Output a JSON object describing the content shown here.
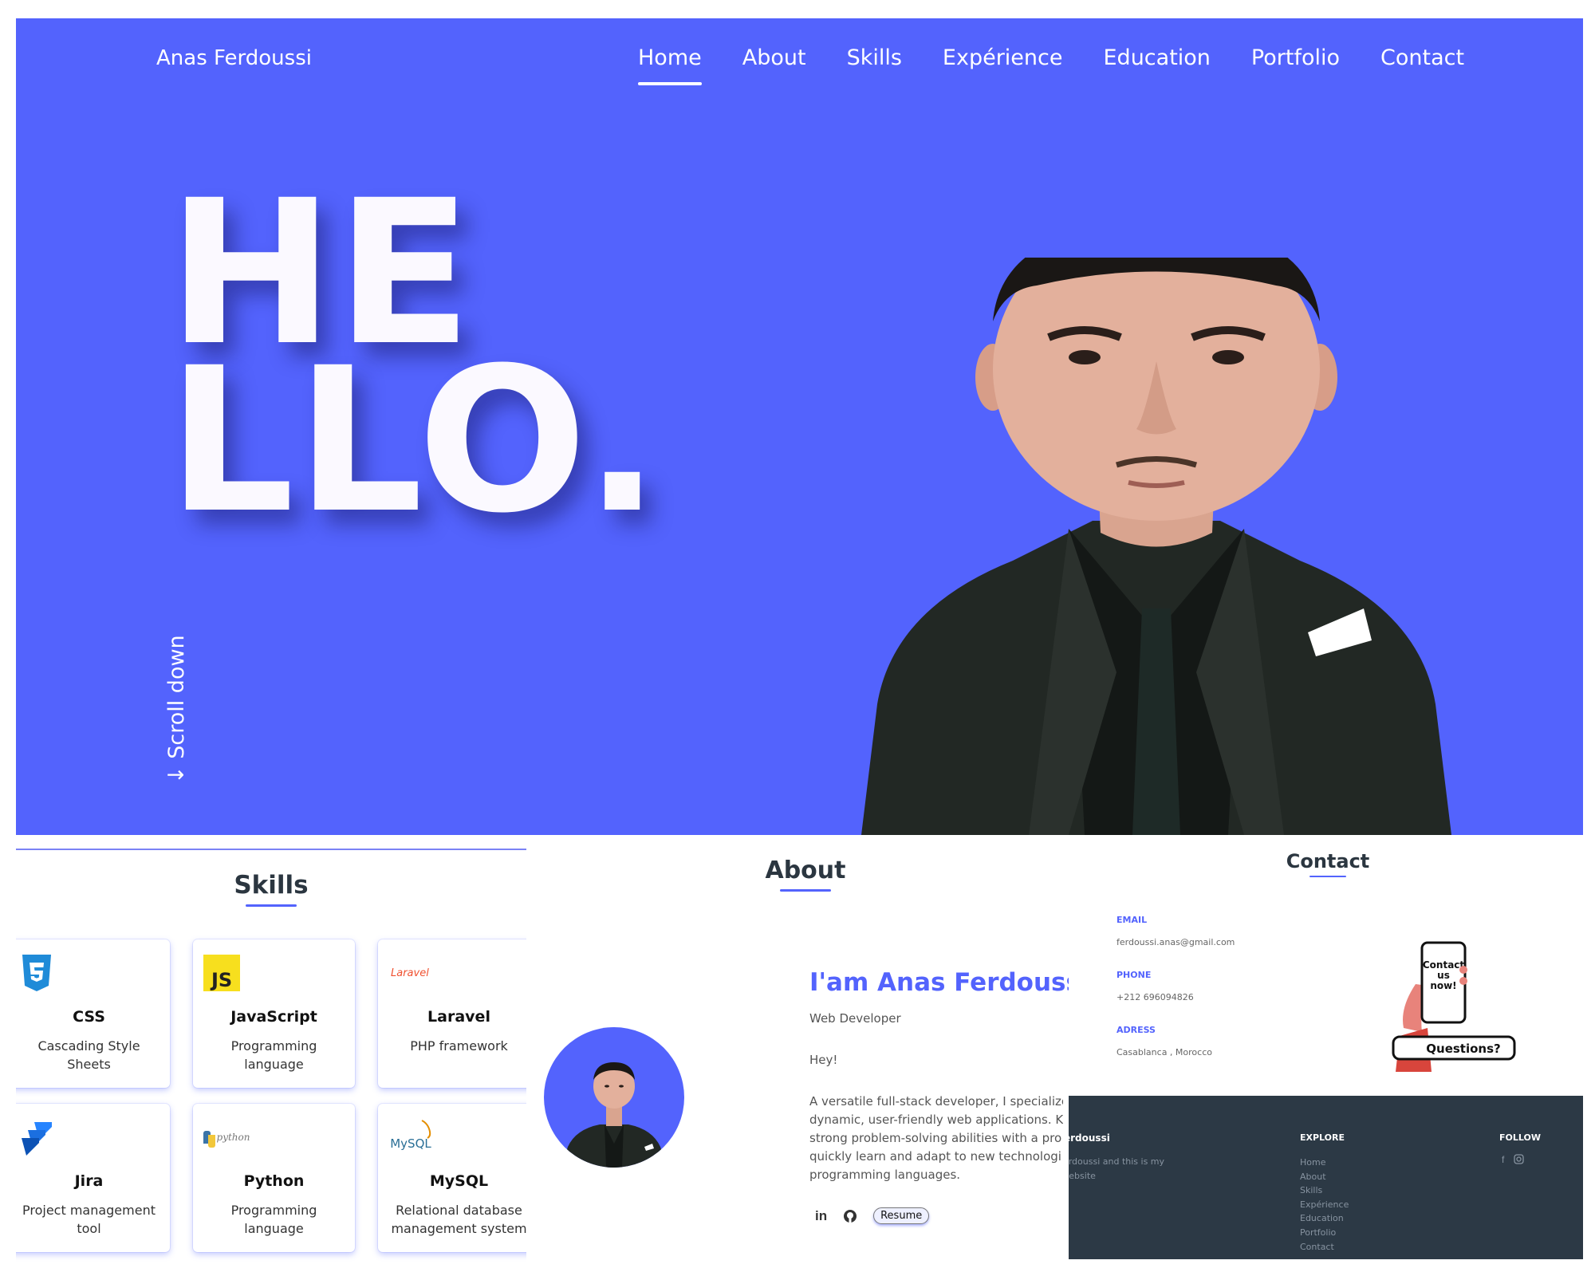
{
  "header": {
    "brand": "Anas Ferdoussi",
    "nav": [
      "Home",
      "About",
      "Skills",
      "Expérience",
      "Education",
      "Portfolio",
      "Contact"
    ],
    "active_nav": "Home"
  },
  "hero": {
    "headline_line1": "HE",
    "headline_line2": "LLO.",
    "scroll_label": "↓ Scroll down"
  },
  "skills": {
    "title": "Skills",
    "items": [
      {
        "name": "CSS",
        "desc": "Cascading Style Sheets",
        "icon": "css3-icon"
      },
      {
        "name": "JavaScript",
        "desc": "Programming language",
        "icon": "javascript-icon"
      },
      {
        "name": "Laravel",
        "desc": "PHP framework",
        "icon": "laravel-icon",
        "icon_text": "Laravel"
      },
      {
        "name": "Jira",
        "desc": "Project management tool",
        "icon": "jira-icon"
      },
      {
        "name": "Python",
        "desc": "Programming language",
        "icon": "python-icon",
        "icon_text": "python"
      },
      {
        "name": "MySQL",
        "desc": "Relational database management system",
        "icon": "mysql-icon",
        "icon_text": "MySQL"
      }
    ]
  },
  "about": {
    "title": "About",
    "name": "I'am Anas Ferdoussi",
    "role": "Web Developer",
    "greeting": "Hey!",
    "lines": [
      "A versatile full-stack developer, I specialize",
      "dynamic, user-friendly web applications. K",
      "strong problem-solving abilities with a pro",
      "quickly learn and adapt to new technologi",
      "programming languages."
    ],
    "resume_label": "Resume",
    "social": [
      "linkedin-icon",
      "github-icon"
    ]
  },
  "contact": {
    "title": "Contact",
    "email_label": "EMAIL",
    "email": "ferdoussi.anas@gmail.com",
    "phone_label": "PHONE",
    "phone": "+212 696094826",
    "address_label": "ADRESS",
    "address": "Casablanca , Morocco",
    "illustration_text_1": "Contact",
    "illustration_text_2": "us",
    "illustration_text_3": "now!",
    "illustration_bubble": "Questions?"
  },
  "footer": {
    "brand": "erdoussi",
    "desc_1": "s Ferdoussi and this is my",
    "desc_2": "al website",
    "explore_title": "EXPLORE",
    "explore_links": [
      "Home",
      "About",
      "Skills",
      "Expérience",
      "Education",
      "Portfolio",
      "Contact"
    ],
    "follow_title": "FOLLOW",
    "follow_icons": [
      "facebook-icon",
      "instagram-icon"
    ]
  },
  "colors": {
    "accent": "#5363fd",
    "footer_bg": "#2c3945",
    "heading": "#2b3640"
  }
}
